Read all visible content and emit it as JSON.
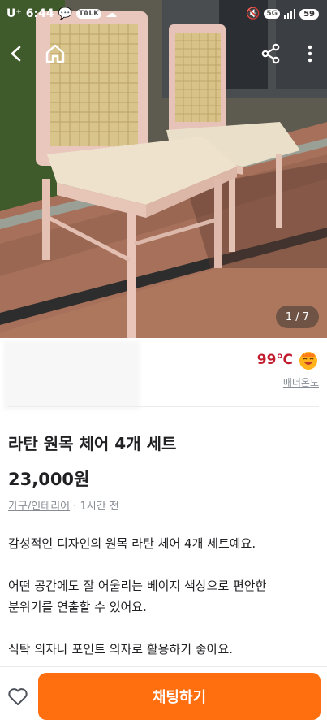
{
  "status": {
    "carrier": "U⁺",
    "time": "6:44",
    "talk_badge": "TALK",
    "signal_badge": "5G",
    "battery": "59"
  },
  "photo": {
    "counter": "1 / 7"
  },
  "seller": {
    "temperature": "99℃",
    "manner_label": "매너온도",
    "temp_color": "#c21d2f"
  },
  "item": {
    "title": "라탄 원목 체어 4개 세트",
    "price": "23,000원",
    "category": "가구/인테리어",
    "time_ago": " · 1시간 전",
    "description": [
      "감성적인 디자인의 원목 라탄 체어 4개 세트예요.",
      "어떤 공간에도 잘 어울리는 베이지 색상으로 편안한",
      "분위기를 연출할 수 있어요.",
      "식탁 의자나 포인트 의자로 활용하기 좋아요."
    ]
  },
  "bottom": {
    "chat_label": "채팅하기",
    "accent": "#ff6f0f"
  },
  "icons": [
    "back-icon",
    "home-icon",
    "share-icon",
    "more-icon",
    "heart-icon",
    "smile-face-icon"
  ]
}
